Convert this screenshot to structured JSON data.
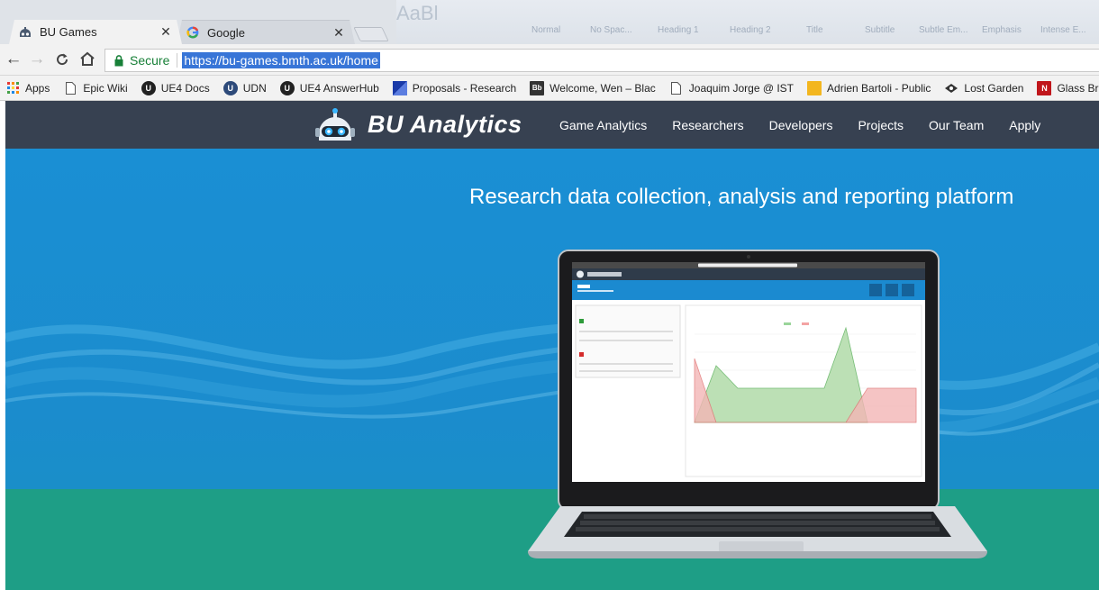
{
  "browser": {
    "tabs": [
      {
        "title": "BU Games",
        "active": true,
        "icon": "bu-robot-icon"
      },
      {
        "title": "Google",
        "active": false,
        "icon": "google-g-icon"
      }
    ],
    "close_glyph": "✕",
    "address": {
      "secure_label": "Secure",
      "url": "https://bu-games.bmth.ac.uk/home"
    },
    "bookmarks": [
      {
        "label": "Apps",
        "icon": "apps-grid-icon"
      },
      {
        "label": "Epic Wiki",
        "icon": "page-icon"
      },
      {
        "label": "UE4 Docs",
        "icon": "unreal-icon"
      },
      {
        "label": "UDN",
        "icon": "unreal-icon"
      },
      {
        "label": "UE4 AnswerHub",
        "icon": "unreal-icon"
      },
      {
        "label": "Proposals - Research",
        "icon": "proposals-icon"
      },
      {
        "label": "Welcome, Wen – Blac",
        "icon": "blackboard-icon"
      },
      {
        "label": "Joaquim Jorge @ IST",
        "icon": "page-icon"
      },
      {
        "label": "Adrien Bartoli - Public",
        "icon": "folder-icon"
      },
      {
        "label": "Lost Garden",
        "icon": "lost-garden-icon"
      },
      {
        "label": "Glass Brain |",
        "icon": "glass-brain-icon"
      }
    ],
    "background_ribbon": [
      "Normal",
      "No Spac...",
      "Heading 1",
      "Heading 2",
      "Title",
      "Subtitle",
      "Subtle Em...",
      "Emphasis",
      "Intense E..."
    ],
    "background_ribbon_big": "AaBl"
  },
  "site": {
    "logo_text": "BU Analytics",
    "menu": [
      "Game Analytics",
      "Researchers",
      "Developers",
      "Projects",
      "Our Team",
      "Apply"
    ],
    "tagline": "Research data collection, analysis and reporting platform"
  },
  "colors": {
    "nav_bg": "#374151",
    "hero_blue": "#1a8fd4",
    "hero_green": "#1e9e86",
    "url_highlight": "#3875d7",
    "secure_green": "#188038"
  }
}
